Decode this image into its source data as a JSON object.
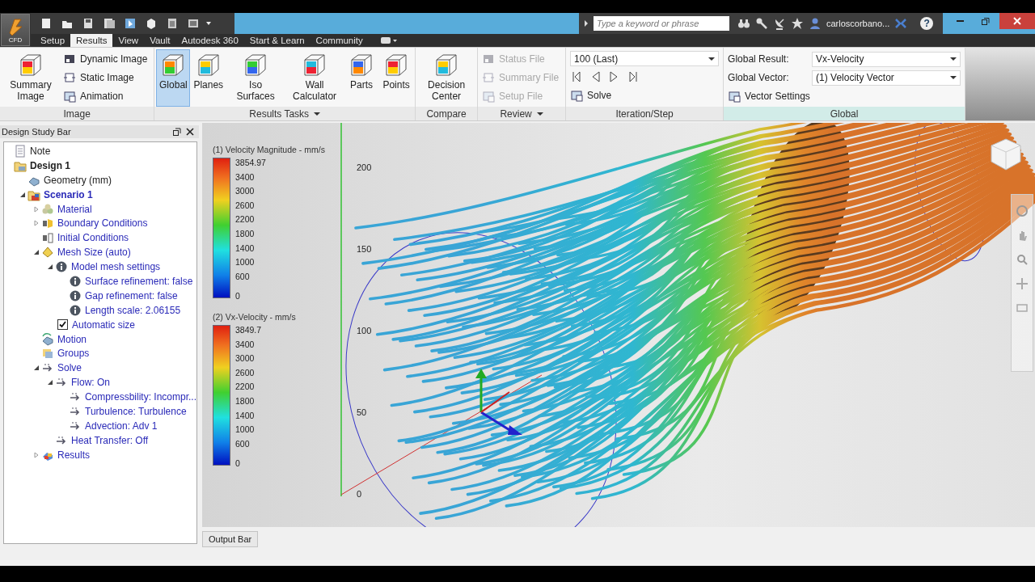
{
  "app_button": {
    "label": "CFD"
  },
  "search": {
    "placeholder": "Type a keyword or phrase"
  },
  "user": {
    "name": "carloscorbano..."
  },
  "help": "?",
  "tabs": [
    {
      "label": "Setup",
      "selected": false
    },
    {
      "label": "Results",
      "selected": true
    },
    {
      "label": "View",
      "selected": false
    },
    {
      "label": "Vault",
      "selected": false
    },
    {
      "label": "Autodesk 360",
      "selected": false
    },
    {
      "label": "Start & Learn",
      "selected": false
    },
    {
      "label": "Community",
      "selected": false
    }
  ],
  "ribbon": [
    {
      "label": "Image",
      "menu": false,
      "highlighted": false,
      "items": [
        {
          "kind": "large",
          "label": "Summary Image",
          "selected": false
        },
        {
          "kind": "small",
          "label": "Dynamic Image",
          "disabled": false
        },
        {
          "kind": "small",
          "label": "Static Image",
          "disabled": false
        },
        {
          "kind": "small",
          "label": "Animation",
          "disabled": false
        }
      ]
    },
    {
      "label": "Results Tasks",
      "menu": true,
      "highlighted": false,
      "items": [
        {
          "kind": "large",
          "label": "Global",
          "selected": true
        },
        {
          "kind": "large",
          "label": "Planes",
          "selected": false
        },
        {
          "kind": "large",
          "label": "Iso Surfaces",
          "selected": false
        },
        {
          "kind": "large",
          "label": "Wall Calculator",
          "selected": false
        },
        {
          "kind": "large",
          "label": "Parts",
          "selected": false
        },
        {
          "kind": "large",
          "label": "Points",
          "selected": false
        }
      ]
    },
    {
      "label": "Compare",
      "menu": false,
      "highlighted": false,
      "items": [
        {
          "kind": "large",
          "label": "Decision Center",
          "selected": false
        }
      ]
    },
    {
      "label": "Review",
      "menu": true,
      "highlighted": false,
      "items": [
        {
          "kind": "small",
          "label": "Status File",
          "disabled": true
        },
        {
          "kind": "small",
          "label": "Summary File",
          "disabled": true
        },
        {
          "kind": "small",
          "label": "Setup File",
          "disabled": true
        }
      ]
    },
    {
      "label": "Iteration/Step",
      "menu": false,
      "highlighted": false,
      "items": [
        {
          "kind": "dropdown",
          "value": "100 (Last)"
        },
        {
          "kind": "nav"
        },
        {
          "kind": "small",
          "label": "Solve",
          "disabled": false
        }
      ]
    },
    {
      "label": "Global",
      "menu": false,
      "highlighted": true,
      "items": [
        {
          "kind": "field",
          "label": "Global Result:",
          "value": "Vx-Velocity"
        },
        {
          "kind": "field",
          "label": "Global Vector:",
          "value": "(1) Velocity Vector"
        },
        {
          "kind": "small",
          "label": "Vector Settings",
          "disabled": false
        }
      ]
    }
  ],
  "design_study_bar": {
    "title": "Design Study Bar",
    "tree": [
      {
        "kind": "note",
        "label": "Note",
        "bold": false,
        "link": false
      },
      {
        "kind": "design",
        "label": "Design 1",
        "bold": true,
        "link": false,
        "children": [
          {
            "kind": "geometry",
            "label": "Geometry (mm)",
            "bold": false,
            "link": false
          },
          {
            "kind": "scenario",
            "label": "Scenario 1",
            "bold": true,
            "link": true,
            "expanded": true,
            "children": [
              {
                "kind": "material",
                "label": "Material",
                "bold": false,
                "link": true,
                "expanded": false
              },
              {
                "kind": "boundary",
                "label": "Boundary Conditions",
                "bold": false,
                "link": true,
                "expanded": false
              },
              {
                "kind": "initial",
                "label": "Initial Conditions",
                "bold": false,
                "link": true
              },
              {
                "kind": "mesh",
                "label": "Mesh Size (auto)",
                "bold": false,
                "link": true,
                "expanded": true,
                "children": [
                  {
                    "kind": "info",
                    "label": "Model mesh settings",
                    "bold": false,
                    "link": true,
                    "expanded": true,
                    "children": [
                      {
                        "kind": "info",
                        "label": "Surface refinement: false",
                        "bold": false,
                        "link": true
                      },
                      {
                        "kind": "info",
                        "label": "Gap refinement: false",
                        "bold": false,
                        "link": true
                      },
                      {
                        "kind": "info",
                        "label": "Length scale: 2.06155",
                        "bold": false,
                        "link": true
                      }
                    ]
                  },
                  {
                    "kind": "check",
                    "label": "Automatic size",
                    "bold": false,
                    "link": true,
                    "checked": true
                  }
                ]
              },
              {
                "kind": "motion",
                "label": "Motion",
                "bold": false,
                "link": true
              },
              {
                "kind": "groups",
                "label": "Groups",
                "bold": false,
                "link": true
              },
              {
                "kind": "solve",
                "label": "Solve",
                "bold": false,
                "link": true,
                "expanded": true,
                "children": [
                  {
                    "kind": "solve",
                    "label": "Flow: On",
                    "bold": false,
                    "link": true,
                    "expanded": true,
                    "children": [
                      {
                        "kind": "solve",
                        "label": "Compressbility: Incompr...",
                        "bold": false,
                        "link": true
                      },
                      {
                        "kind": "solve",
                        "label": "Turbulence: Turbulence",
                        "bold": false,
                        "link": true
                      },
                      {
                        "kind": "solve",
                        "label": "Advection: Adv 1",
                        "bold": false,
                        "link": true
                      }
                    ]
                  },
                  {
                    "kind": "solve",
                    "label": "Heat Transfer: Off",
                    "bold": false,
                    "link": true
                  }
                ]
              },
              {
                "kind": "results",
                "label": "Results",
                "bold": false,
                "link": true,
                "expanded": false
              }
            ]
          }
        ]
      }
    ]
  },
  "legends": [
    {
      "title": "(1) Velocity Magnitude - mm/s",
      "max": "3854.97",
      "ticks": [
        "3400",
        "3000",
        "2600",
        "2200",
        "1800",
        "1400",
        "1000",
        "600",
        "0"
      ]
    },
    {
      "title": "(2) Vx-Velocity - mm/s",
      "max": "3849.7",
      "ticks": [
        "3400",
        "3000",
        "2600",
        "2200",
        "1800",
        "1400",
        "1000",
        "600",
        "0"
      ]
    }
  ],
  "axis_labels": [
    "200",
    "150",
    "100",
    "50",
    "0"
  ],
  "output_bar": {
    "label": "Output Bar"
  }
}
